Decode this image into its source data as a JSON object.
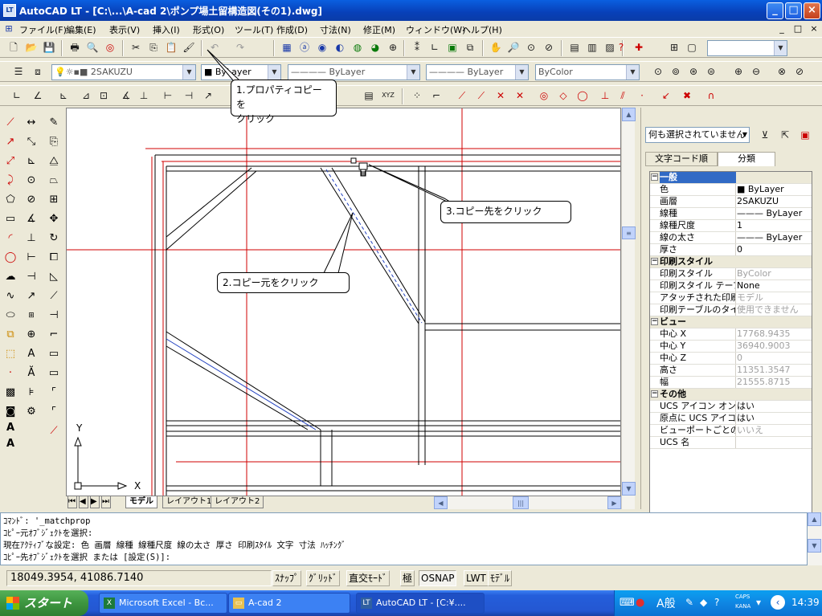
{
  "window": {
    "app_icon": "LT",
    "title": "AutoCAD LT - [C:\\...\\A-cad 2\\ポンプ場土留構造図(その1).dwg]",
    "minimize": "_",
    "maximize": "□",
    "close": "×"
  },
  "menu": {
    "app_icon": "ucs-icon",
    "items": [
      "ファイル(F)",
      "編集(E)",
      "表示(V)",
      "挿入(I)",
      "形式(O)",
      "ツール(T)",
      "作成(D)",
      "寸法(N)",
      "修正(M)",
      "ウィンドウ(W)",
      "ヘルプ(H)"
    ],
    "doc_controls": [
      "_",
      "□",
      "×"
    ]
  },
  "toolbars": {
    "layer_combo": "2SAKUZU",
    "color_combo": "ByLayer",
    "linetype_combo": "ByLayer",
    "lineweight_combo": "ByLayer",
    "plotstyle_combo": "ByColor",
    "view_combo": ""
  },
  "callouts": {
    "step1": "1.プロパティコピーを\nクリック",
    "step2": "2.コピー元をクリック",
    "step3": "3.コピー先をクリック"
  },
  "drawing": {
    "ucs_x": "X",
    "ucs_y": "Y"
  },
  "layout_tabs": [
    "モデル",
    "レイアウト1",
    "レイアウト2"
  ],
  "properties": {
    "selection": "何も選択されていません",
    "tabs": [
      "文字コード順",
      "分類"
    ],
    "active_tab": 1,
    "categories": [
      {
        "name": "一般",
        "rows": [
          {
            "key": "色",
            "value": "■ ByLayer"
          },
          {
            "key": "画層",
            "value": "2SAKUZU"
          },
          {
            "key": "線種",
            "value": "——— ByLayer"
          },
          {
            "key": "線種尺度",
            "value": "1"
          },
          {
            "key": "線の太さ",
            "value": "——— ByLayer"
          },
          {
            "key": "厚さ",
            "value": "0"
          }
        ]
      },
      {
        "name": "印刷スタイル",
        "rows": [
          {
            "key": "印刷スタイル",
            "value": "ByColor",
            "dim": true
          },
          {
            "key": "印刷スタイル テーブル",
            "value": "None"
          },
          {
            "key": "アタッチされた印刷テーブル",
            "value": "モデル",
            "dim": true
          },
          {
            "key": "印刷テーブルのタイプ",
            "value": "使用できません",
            "dim": true
          }
        ]
      },
      {
        "name": "ビュー",
        "rows": [
          {
            "key": "中心 X",
            "value": "17768.9435",
            "dim": true
          },
          {
            "key": "中心 Y",
            "value": "36940.9003",
            "dim": true
          },
          {
            "key": "中心 Z",
            "value": "0",
            "dim": true
          },
          {
            "key": "高さ",
            "value": "11351.3547",
            "dim": true
          },
          {
            "key": "幅",
            "value": "21555.8715",
            "dim": true
          }
        ]
      },
      {
        "name": "その他",
        "rows": [
          {
            "key": "UCS アイコン オン",
            "value": "はい"
          },
          {
            "key": "原点に UCS アイコン",
            "value": "はい"
          },
          {
            "key": "ビューポートごとの UCS",
            "value": "いいえ",
            "dim": true
          },
          {
            "key": "UCS 名",
            "value": ""
          }
        ]
      }
    ]
  },
  "command": {
    "lines": [
      "ｺﾏﾝﾄﾞ: '_matchprop",
      "ｺﾋﾟｰ元ｵﾌﾞｼﾞｪｸﾄを選択:",
      "現在ｱｸﾃｨﾌﾞな設定:  色  画層  線種  線種尺度  線の太さ  厚さ  印刷ｽﾀｲﾙ  文字  寸法  ﾊｯﾁﾝｸﾞ",
      "ｺﾋﾟｰ先ｵﾌﾞｼﾞｪｸﾄを選択 または [設定(S)]:"
    ]
  },
  "status": {
    "coords": "18049.3954, 41086.7140",
    "buttons": [
      {
        "label": "ｽﾅｯﾌﾟ",
        "on": false
      },
      {
        "label": "ｸﾞﾘｯﾄﾞ",
        "on": false
      },
      {
        "label": "直交ﾓｰﾄﾞ",
        "on": false
      },
      {
        "label": "極",
        "on": false
      },
      {
        "label": "OSNAP",
        "on": true
      },
      {
        "label": "LWT",
        "on": false
      },
      {
        "label": "ﾓﾃﾞﾙ",
        "on": false
      }
    ]
  },
  "taskbar": {
    "start": "スタート",
    "tasks": [
      {
        "label": "Microsoft Excel - Bc...",
        "icon": "excel-icon"
      },
      {
        "label": "A-cad 2",
        "icon": "folder-icon"
      },
      {
        "label": "AutoCAD LT - [C:¥....",
        "icon": "autocad-icon",
        "active": true
      }
    ],
    "ime": "A般",
    "caps": "CAPS",
    "kana": "KANA",
    "clock": "14:39"
  }
}
